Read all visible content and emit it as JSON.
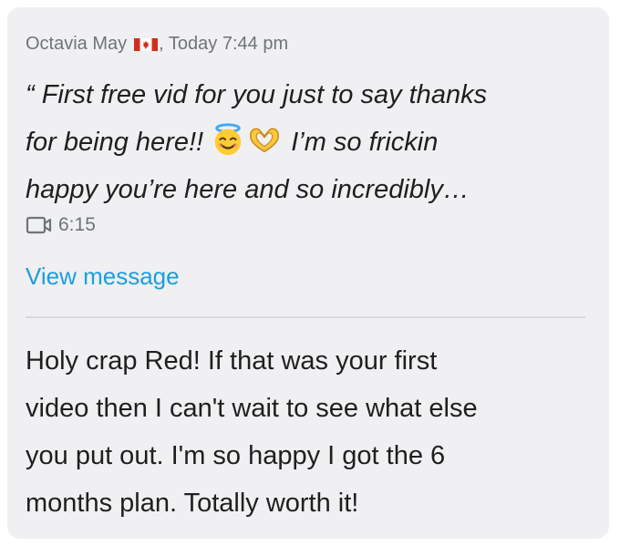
{
  "message": {
    "sender_name": "Octavia May",
    "sender_flag": "canada-flag-icon",
    "timestamp": ", Today 7:44 pm",
    "quote_line_1": "“ First free vid for you just to say thanks",
    "quote_line_2a": "for being here!! ",
    "quote_line_2b": " I’m so frickin",
    "quote_line_3": "happy you’re here and so incredibly…",
    "emojis": [
      "smiling-face-with-halo-icon",
      "heart-hands-icon"
    ],
    "video_icon": "video-camera-icon",
    "video_duration": "6:15",
    "view_link_label": "View message"
  },
  "reply": {
    "line_1": "Holy crap Red! If that was your first",
    "line_2": "video then I can't wait to see what else",
    "line_3": "you put out. I'm so happy I got the 6",
    "line_4": "months plan. Totally worth it!"
  },
  "colors": {
    "card_background": "#f0f0f2",
    "meta_text": "#6e7479",
    "link": "#1a9ee0",
    "body_text": "#1f1f1f",
    "divider": "#d8d9db"
  }
}
